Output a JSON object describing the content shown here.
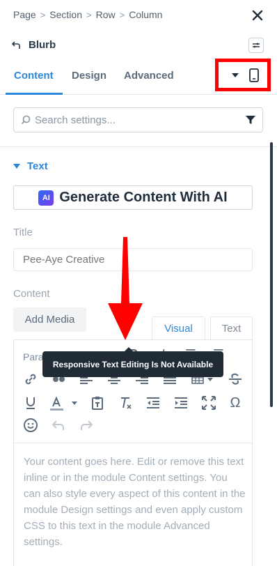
{
  "breadcrumb": [
    "Page",
    "Section",
    "Row",
    "Column"
  ],
  "breadcrumb_separator": ">",
  "module_title": "Blurb",
  "tabs": [
    {
      "label": "Content",
      "active": true
    },
    {
      "label": "Design",
      "active": false
    },
    {
      "label": "Advanced",
      "active": false
    }
  ],
  "search": {
    "placeholder": "Search settings...",
    "value": ""
  },
  "section": {
    "label": "Text",
    "expanded": true
  },
  "ai_button": {
    "badge": "AI",
    "label": "Generate Content With AI"
  },
  "title_field": {
    "label": "Title",
    "placeholder": "Pee-Aye Creative",
    "value": ""
  },
  "content_field": {
    "label": "Content"
  },
  "add_media_label": "Add Media",
  "editor_tabs": {
    "visual": "Visual",
    "text": "Text"
  },
  "paragraph_label": "Para",
  "tooltip": "Responsive Text Editing Is Not Available",
  "editor_body": "Your content goes here. Edit or remove this text inline or in the module Content settings. You can also style every aspect of this content in the module Design settings and even apply custom CSS to this text in the module Advanced settings.",
  "colors": {
    "accent": "#2b87da",
    "annotation": "#ff0000",
    "tooltip_bg": "#202b36"
  }
}
